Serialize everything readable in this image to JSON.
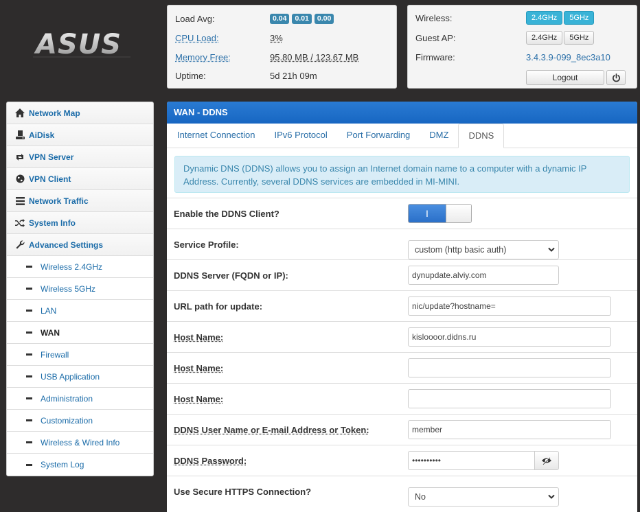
{
  "brand": {
    "logo_text": "ASUS"
  },
  "status": {
    "load_avg_label": "Load Avg:",
    "load_avg": [
      "0.04",
      "0.01",
      "0.00"
    ],
    "cpu_label": "CPU Load:",
    "cpu_value": "3%",
    "mem_label": "Memory Free:",
    "mem_value": "95.80 MB / 123.67 MB",
    "uptime_label": "Uptime:",
    "uptime_value": "5d 21h 09m",
    "wireless_label": "Wireless:",
    "guest_label": "Guest AP:",
    "band_24": "2.4GHz",
    "band_5": "5GHz",
    "firmware_label": "Firmware:",
    "firmware_value": "3.4.3.9-099_8ec3a10",
    "logout_label": "Logout"
  },
  "sidebar": {
    "items": [
      {
        "label": "Network Map",
        "icon": "home-icon"
      },
      {
        "label": "AiDisk",
        "icon": "disk-icon"
      },
      {
        "label": "VPN Server",
        "icon": "retweet-icon"
      },
      {
        "label": "VPN Client",
        "icon": "globe-icon"
      },
      {
        "label": "Network Traffic",
        "icon": "list-icon"
      },
      {
        "label": "System Info",
        "icon": "shuffle-icon"
      },
      {
        "label": "Advanced Settings",
        "icon": "wrench-icon"
      }
    ],
    "sub_items": [
      "Wireless 2.4GHz",
      "Wireless 5GHz",
      "LAN",
      "WAN",
      "Firewall",
      "USB Application",
      "Administration",
      "Customization",
      "Wireless & Wired Info",
      "System Log"
    ],
    "active_sub": "WAN"
  },
  "panel": {
    "title": "WAN - DDNS",
    "tabs": [
      "Internet Connection",
      "IPv6 Protocol",
      "Port Forwarding",
      "DMZ",
      "DDNS"
    ],
    "active_tab": "DDNS",
    "info": "Dynamic DNS (DDNS) allows you to assign an Internet domain name to a computer with a dynamic IP Address. Currently, several DDNS services are embedded in MI-MINI."
  },
  "form": {
    "enable_label": "Enable the DDNS Client?",
    "enable_on_glyph": "I",
    "profile_label": "Service Profile:",
    "profile_value": "custom (http basic auth)",
    "server_label": "DDNS Server (FQDN or IP):",
    "server_value": "dynupdate.alviy.com",
    "url_label": "URL path for update:",
    "url_value": "nic/update?hostname=",
    "host1_label": "Host Name:",
    "host1_value": "kisloooor.didns.ru",
    "host2_label": "Host Name:",
    "host2_value": "",
    "host3_label": "Host Name:",
    "host3_value": "",
    "user_label": "DDNS User Name or E-mail Address or Token:",
    "user_value": "member",
    "pass_label": "DDNS Password:",
    "pass_value": "••••••••••",
    "https_label": "Use Secure HTTPS Connection?",
    "https_value": "No"
  },
  "colors": {
    "accent": "#1766c2",
    "link": "#1a6ba8",
    "badge": "#3a87ad",
    "background": "#2e2c2c"
  }
}
